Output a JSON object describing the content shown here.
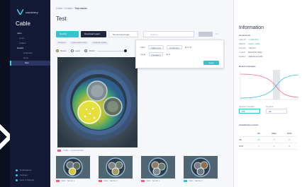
{
  "app": {
    "brand": "vasiotery",
    "section_title": "Cable"
  },
  "sidebar": {
    "items": [
      {
        "label": "Jobs",
        "kind": "group"
      },
      {
        "label": "Lines",
        "kind": "item"
      },
      {
        "label": "Cables",
        "kind": "item"
      },
      {
        "label": "Details",
        "kind": "group"
      },
      {
        "label": "Overview",
        "kind": "sub"
      },
      {
        "label": "Runs",
        "kind": "sub"
      },
      {
        "label": "Test",
        "kind": "sub",
        "active": true
      }
    ],
    "footer": [
      "Notifications",
      "Settings",
      "Help & Support"
    ]
  },
  "breadcrumb": {
    "items": [
      "Cable",
      "Details",
      "Test results"
    ]
  },
  "main": {
    "title": "Test",
    "toolbar": {
      "primary": "Results",
      "secondary": "Download report",
      "tertiary": "Set as test image",
      "search_placeholder": "Search...",
      "icons": "⟳  ⋮"
    },
    "filters": [
      "All layers",
      "Cross-section view",
      "Heatmap overlay"
    ],
    "legend": {
      "items": [
        "Defect",
        "Layer",
        "Shield"
      ],
      "colors": [
        "#f7e047",
        "#ffffff",
        "#d8dbe6"
      ]
    },
    "caption": "Cable · Cross-section",
    "thumbnails": [
      {
        "caption": "Cable · Sample 1",
        "tag_color": "#ff5a7a"
      },
      {
        "caption": "Cable · Sample 2",
        "tag_color": "#ff5a7a"
      },
      {
        "caption": "Cable · Sample 3",
        "tag_color": "#ff5a7a"
      },
      {
        "caption": "Cable · Sample 4",
        "tag_color": "#36c2cf"
      }
    ]
  },
  "overlay": {
    "row1": {
      "label": "Filter",
      "select": "Cable type",
      "value": "Conductor"
    },
    "row2": {
      "label": "Layer",
      "select": "Insulation"
    },
    "apply": "Apply"
  },
  "info": {
    "title": "Information",
    "subtitle": "General info",
    "fields": [
      {
        "k": "Cable ID",
        "v": "C-2024-0117",
        "accent": true
      },
      {
        "k": "Material",
        "v": "Copper / XLPE",
        "accent": true
      },
      {
        "k": "Diameter",
        "v": "34.6 mm",
        "accent": false
      },
      {
        "k": "Created",
        "v": "2024-03-11 09:42",
        "accent": false
      },
      {
        "k": "Modified",
        "v": "2024-03-12 14:05",
        "accent": false
      }
    ],
    "chart_section": "Result of Analysis",
    "select_a_label": "Detection threshold",
    "select_b_label": "Compare",
    "select_a": "0.5",
    "select_b": "All",
    "table_section": "Classification results",
    "table": {
      "headers": [
        "",
        "OK",
        "Warn",
        "NOK"
      ],
      "rows": [
        {
          "name": "OK",
          "values": [
            "12",
            "3",
            "0"
          ]
        },
        {
          "name": "NOK",
          "values": [
            "1",
            "2",
            "9"
          ]
        }
      ]
    }
  }
}
